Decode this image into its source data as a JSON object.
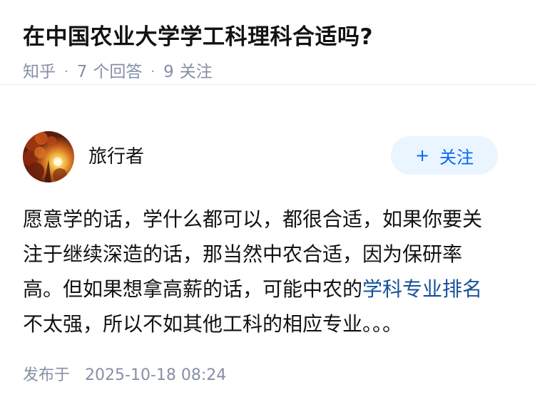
{
  "question": {
    "title": "在中国农业大学学工科理科合适吗?",
    "source": "知乎",
    "answer_count": "7",
    "answer_label": "个回答",
    "follower_count": "9",
    "follower_label": "关注"
  },
  "answer": {
    "author": {
      "name": "旅行者",
      "follow_label": "关注",
      "follow_icon": "plus-icon"
    },
    "content": {
      "before_link": "愿意学的话，学什么都可以，都很合适，如果你要关注于继续深造的话，那当然中农合适，因为保研率高。但如果想拿高薪的话，可能中农的",
      "link_text": "学科专业排名",
      "after_link": "不太强，所以不如其他工科的相应专业。。。"
    },
    "publish_label": "发布于",
    "publish_time": "2025-10-18 08:24"
  },
  "colors": {
    "link": "#175199",
    "meta": "#8590a6",
    "accent": "#0066ff",
    "follow_bg": "#ebf5ff"
  }
}
